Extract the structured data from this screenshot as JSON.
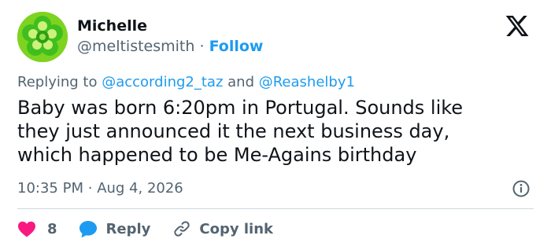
{
  "author": {
    "name": "Michelle",
    "handle": "@meltistesmith",
    "separator": "·",
    "follow_label": "Follow",
    "avatar_icon": "green-flower-icon",
    "avatar_color": "#7ed321"
  },
  "brand": {
    "logo_icon": "x-logo-icon"
  },
  "reply_context": {
    "prefix": "Replying to",
    "mention_1": "@according2_taz",
    "joiner": "and",
    "mention_2": "@Reashelby1"
  },
  "tweet": {
    "lines": [
      "Baby was born 6:20pm in Portugal.  Sounds like",
      "they just announced it the next business day,",
      "which happened to be Me-Agains birthday"
    ],
    "time": "10:35 PM",
    "date_separator": "·",
    "date": "Aug 4, 2026"
  },
  "actions": {
    "like_count": "8",
    "reply_label": "Reply",
    "copy_link_label": "Copy link"
  },
  "colors": {
    "accent": "#1d9bf0",
    "like": "#f91880",
    "secondary_text": "#536471",
    "divider": "#cfd9de"
  }
}
